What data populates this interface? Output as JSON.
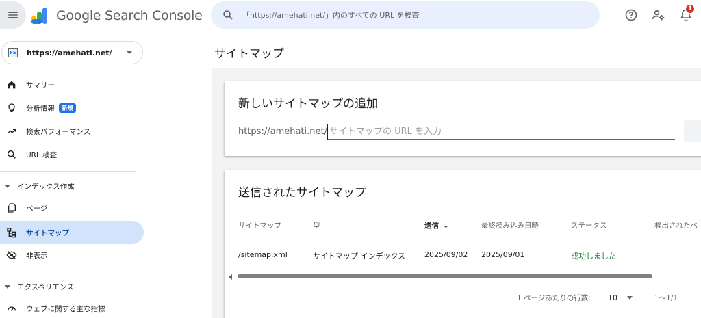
{
  "header": {
    "product_name": "Google Search Console",
    "search_placeholder": "「https://amehati.net/」内のすべての URL を検査",
    "notification_count": "1",
    "colors": {
      "search_bg": "#e8f0fe",
      "badge": "#d93025"
    }
  },
  "sidebar": {
    "property": {
      "icon_text": "FS",
      "url": "https://amehati.net/"
    },
    "items_top": [
      {
        "label": "サマリー",
        "icon": "home-icon"
      },
      {
        "label": "分析情報",
        "icon": "lightbulb-icon",
        "badge": "新規"
      },
      {
        "label": "検索パフォーマンス",
        "icon": "trending-up-icon"
      },
      {
        "label": "URL 検査",
        "icon": "search-icon"
      }
    ],
    "section_index": {
      "title": "インデックス作成",
      "items": [
        {
          "label": "ページ",
          "icon": "pages-icon"
        },
        {
          "label": "サイトマップ",
          "icon": "sitemap-icon",
          "active": true
        },
        {
          "label": "非表示",
          "icon": "visibility-off-icon"
        }
      ]
    },
    "section_experience": {
      "title": "エクスペリエンス",
      "items": [
        {
          "label": "ウェブに関する主な指標",
          "icon": "speed-icon"
        }
      ]
    },
    "colors": {
      "active_bg": "#d2e3fc",
      "active_text": "#174ea6"
    }
  },
  "main": {
    "page_title": "サイトマップ",
    "add_card": {
      "title": "新しいサイトマップの追加",
      "prefix": "https://amehati.net/",
      "input_placeholder": "サイトマップの URL を入力"
    },
    "submitted_card": {
      "title": "送信されたサイトマップ",
      "columns": [
        "サイトマップ",
        "型",
        "送信",
        "最終読み込み日時",
        "ステータス",
        "検出されたペ"
      ],
      "sorted_column": "送信",
      "rows": [
        {
          "sitemap": "/sitemap.xml",
          "type": "サイトマップ インデックス",
          "submitted": "2025/09/02",
          "last_read": "2025/09/01",
          "status": "成功しました"
        }
      ],
      "pager": {
        "rows_per_page_label": "1 ページあたりの行数:",
        "rows_per_page": "10",
        "range": "1〜1/1"
      }
    }
  }
}
